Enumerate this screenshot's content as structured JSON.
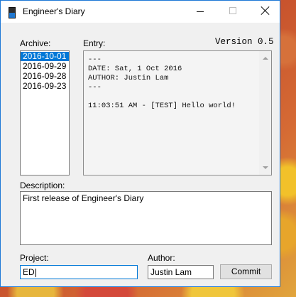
{
  "window": {
    "title": "Engineer's Diary",
    "version": "Version 0.5"
  },
  "labels": {
    "archive": "Archive:",
    "entry": "Entry:",
    "description": "Description:",
    "project": "Project:",
    "author": "Author:"
  },
  "archive": {
    "items": [
      "2016-10-01",
      "2016-09-29",
      "2016-09-28",
      "2016-09-23"
    ],
    "selected_index": 0
  },
  "entry": {
    "text": "---\nDATE: Sat, 1 Oct 2016\nAUTHOR: Justin Lam\n---\n\n11:03:51 AM - [TEST] Hello world!"
  },
  "description": {
    "value": "First release of Engineer's Diary"
  },
  "project": {
    "value": "ED"
  },
  "author": {
    "value": "Justin Lam"
  },
  "buttons": {
    "commit": "Commit"
  },
  "colors": {
    "accent": "#0078d7",
    "window_border": "#1e78d6"
  }
}
